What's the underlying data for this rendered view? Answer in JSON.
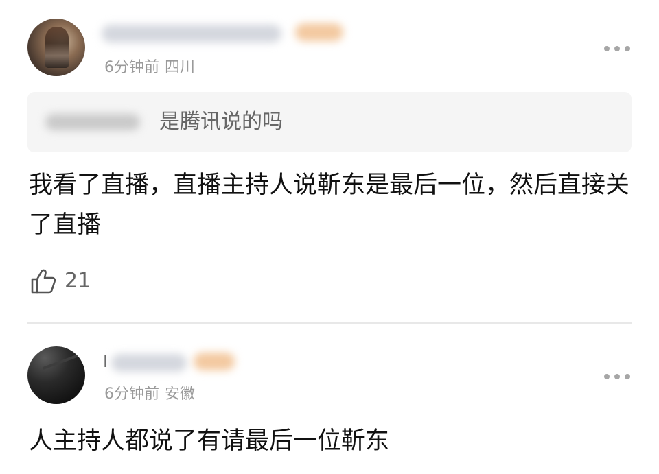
{
  "comments": [
    {
      "username": "",
      "time": "6分钟前",
      "location": "四川",
      "quote": {
        "username": "",
        "text": "是腾讯说的吗"
      },
      "text": "我看了直播，直播主持人说靳东是最后一位，然后直接关了直播",
      "likes": "21"
    },
    {
      "username_initial": "I",
      "time": "6分钟前",
      "location": "安徽",
      "text": "人主持人都说了有请最后一位靳东"
    }
  ],
  "icons": {
    "like": "thumbs-up-icon",
    "more": "more-dots-icon"
  },
  "colors": {
    "meta_text": "#9a9a9a",
    "quote_bg": "#f5f5f5",
    "badge_blur": "#f3c9a0"
  }
}
